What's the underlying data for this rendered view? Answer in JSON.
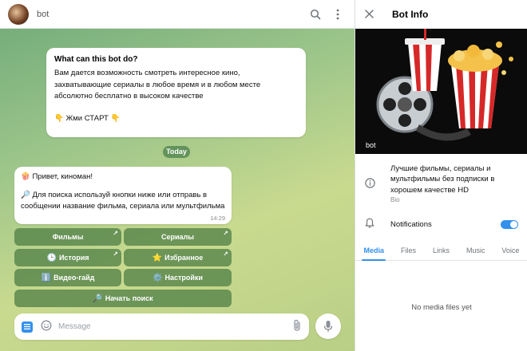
{
  "chat": {
    "title": "bot",
    "info_card": {
      "title": "What can this bot do?",
      "text": "Вам дается возможность смотреть интересное кино, захватывающие сериалы в любое время и в любом месте абсолютно бесплатно в высоком качестве",
      "start_line": "👇 Жми СТАРТ 👇"
    },
    "date_separator": "Today",
    "message": {
      "line1": "🍿 Привет, киноман!",
      "line2": "🔎 Для поиска используй кнопки ниже или отправь в сообщении название фильма, сериала или мультфильма",
      "time": "14:29"
    },
    "keyboard": [
      {
        "icon": "",
        "label": "Фильмы",
        "arrow": true
      },
      {
        "icon": "",
        "label": "Сериалы",
        "arrow": true
      },
      {
        "icon": "🕒",
        "label": "История",
        "arrow": true
      },
      {
        "icon": "⭐",
        "label": "Избранное",
        "arrow": true
      },
      {
        "icon": "ℹ️",
        "label": "Видео-гайд",
        "arrow": false
      },
      {
        "icon": "⚙️",
        "label": "Настройки",
        "arrow": false
      },
      {
        "icon": "🔎",
        "label": "Начать поиск",
        "arrow": false
      }
    ],
    "composer": {
      "placeholder": "Message"
    }
  },
  "panel": {
    "title": "Bot Info",
    "cover_name": "bot",
    "bio": {
      "text": "Лучшие фильмы, сериалы и мультфильмы без подписки в хорошем качестве HD",
      "label": "Bio"
    },
    "notifications": {
      "label": "Notifications",
      "enabled": true
    },
    "tabs": [
      "Media",
      "Files",
      "Links",
      "Music",
      "Voice"
    ],
    "active_tab": "Media",
    "empty_text": "No media files yet"
  },
  "colors": {
    "accent": "#3390ec",
    "keyboard_button": "#528248",
    "date_pill": "#4a8049"
  },
  "icons": {
    "header_search": "search-icon",
    "header_menu": "more-vertical-icon",
    "close": "close-icon",
    "bio": "info-icon",
    "notifications": "bell-icon",
    "attach": "paperclip-icon",
    "mic": "microphone-icon",
    "emoji": "smile-icon",
    "bot_menu": "bot-menu-icon"
  }
}
